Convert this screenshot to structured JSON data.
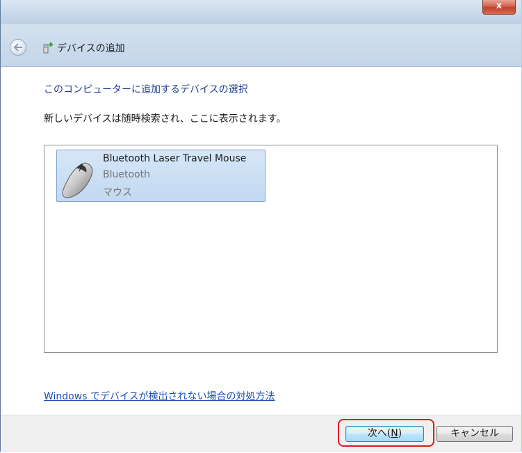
{
  "window": {
    "close_label": "x"
  },
  "header": {
    "title": "デバイスの追加"
  },
  "main": {
    "heading": "このコンピューターに追加するデバイスの選択",
    "instruction": "新しいデバイスは随時検索され、ここに表示されます。",
    "devices": [
      {
        "name": "Bluetooth Laser Travel Mouse",
        "type": "Bluetooth",
        "category": "マウス",
        "icon": "mouse-icon",
        "selected": true
      }
    ],
    "help_link": "Windows でデバイスが検出されない場合の対処方法"
  },
  "footer": {
    "next_label": "次へ(N)",
    "cancel_label": "キャンセル"
  },
  "colors": {
    "heading": "#1e3c8f",
    "link": "#1a4fb4",
    "selection_tile": "#c2d9f1",
    "highlight_border": "#d81b25"
  }
}
